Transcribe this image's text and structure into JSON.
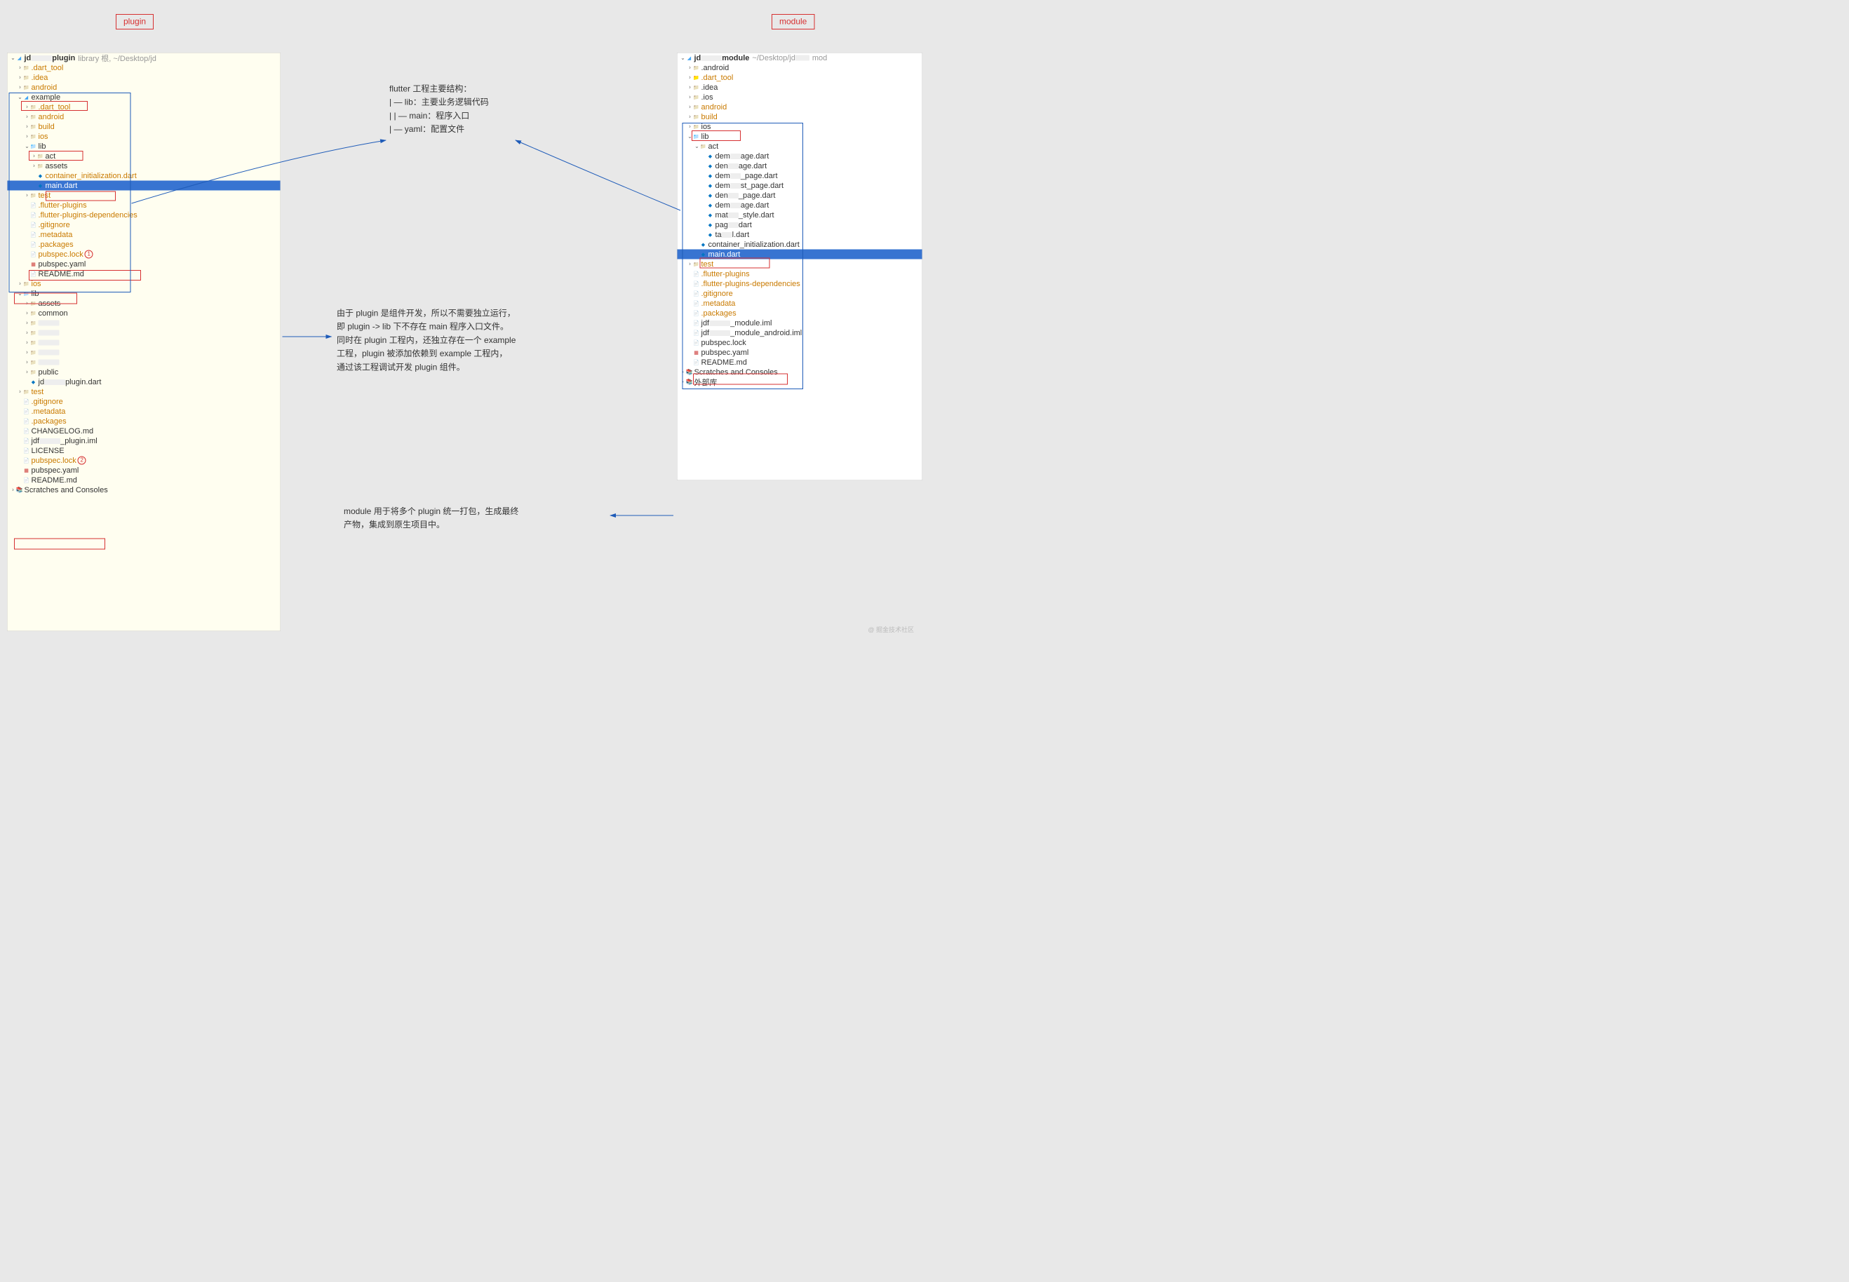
{
  "labels": {
    "plugin": "plugin",
    "module": "module"
  },
  "annotations": {
    "structure_title": "flutter 工程主要结构：",
    "structure_lib": "| — lib：主要业务逻辑代码",
    "structure_main": "|      | — main：程序入口",
    "structure_yaml": "| — yaml：配置文件",
    "plugin_desc_1": "由于 plugin 是组件开发，所以不需要独立运行，",
    "plugin_desc_2": "即 plugin -> lib 下不存在 main 程序入口文件。",
    "plugin_desc_3": "同时在 plugin 工程内，还独立存在一个 example",
    "plugin_desc_4": "工程，plugin 被添加依赖到 example 工程内，",
    "plugin_desc_5": "通过该工程调试开发 plugin 组件。",
    "module_desc_1": "module 用于将多个 plugin 统一打包，生成最终",
    "module_desc_2": "产物，集成到原生项目中。"
  },
  "plugin_tree": {
    "root_prefix": "jd",
    "root_suffix": "plugin",
    "root_info": "library 根, ~/Desktop/jd",
    "items": {
      "dart_tool": ".dart_tool",
      "idea": ".idea",
      "android": "android",
      "example": "example",
      "ex_dart_tool": ".dart_tool",
      "ex_android": "android",
      "ex_build": "build",
      "ex_ios": "ios",
      "ex_lib": "lib",
      "ex_act": "act",
      "ex_assets": "assets",
      "ex_container": "container_initialization.dart",
      "ex_main": "main.dart",
      "ex_test": "test",
      "ex_flutter_plugins": ".flutter-plugins",
      "ex_flutter_plugins_deps": ".flutter-plugins-dependencies",
      "ex_gitignore": ".gitignore",
      "ex_metadata": ".metadata",
      "ex_packages": ".packages",
      "ex_pubspec_lock": "pubspec.lock",
      "ex_pubspec_yaml": "pubspec.yaml",
      "ex_readme": "README.md",
      "ios": "ios",
      "lib": "lib",
      "assets": "assets",
      "common": "common",
      "public": "public",
      "plugin_dart_prefix": "jd",
      "plugin_dart_suffix": "plugin.dart",
      "test": "test",
      "gitignore": ".gitignore",
      "metadata": ".metadata",
      "packages": ".packages",
      "changelog": "CHANGELOG.md",
      "iml_prefix": "jdf",
      "iml_suffix": "_plugin.iml",
      "license": "LICENSE",
      "pubspec_lock": "pubspec.lock",
      "pubspec_yaml": "pubspec.yaml",
      "readme": "README.md",
      "scratches": "Scratches and Consoles"
    },
    "badges": {
      "b1": "1",
      "b2": "2"
    }
  },
  "module_tree": {
    "root_prefix": "jd",
    "root_suffix": "module",
    "root_info": "~/Desktop/jd",
    "root_tail": "mod",
    "items": {
      "android": ".android",
      "dart_tool": ".dart_tool",
      "idea": ".idea",
      "ios": ".ios",
      "android2": "android",
      "build": "build",
      "ios2": "ios",
      "lib": "lib",
      "act": "act",
      "f1_pre": "dem",
      "f1_suf": "age.dart",
      "f2_pre": "den",
      "f2_suf": "age.dart",
      "f3_pre": "dem",
      "f3_suf": "_page.dart",
      "f4_pre": "dem",
      "f4_suf": "st_page.dart",
      "f5_pre": "den",
      "f5_suf": "_page.dart",
      "f6_pre": "dem",
      "f6_suf": "age.dart",
      "f7_pre": "mat",
      "f7_suf": "_style.dart",
      "f8_pre": "pag",
      "f8_suf": "dart",
      "f9_pre": "ta",
      "f9_suf": "l.dart",
      "container": "container_initialization.dart",
      "main": "main.dart",
      "test": "test",
      "flutter_plugins": ".flutter-plugins",
      "flutter_plugins_deps": ".flutter-plugins-dependencies",
      "gitignore": ".gitignore",
      "metadata": ".metadata",
      "packages": ".packages",
      "iml1_pre": "jdf",
      "iml1_suf": "_module.iml",
      "iml2_pre": "jdf",
      "iml2_suf": "_module_android.iml",
      "pubspec_lock": "pubspec.lock",
      "pubspec_yaml": "pubspec.yaml",
      "readme": "README.md",
      "scratches": "Scratches and Consoles",
      "external": "外部库"
    }
  },
  "watermark": "@ 掘金技术社区"
}
